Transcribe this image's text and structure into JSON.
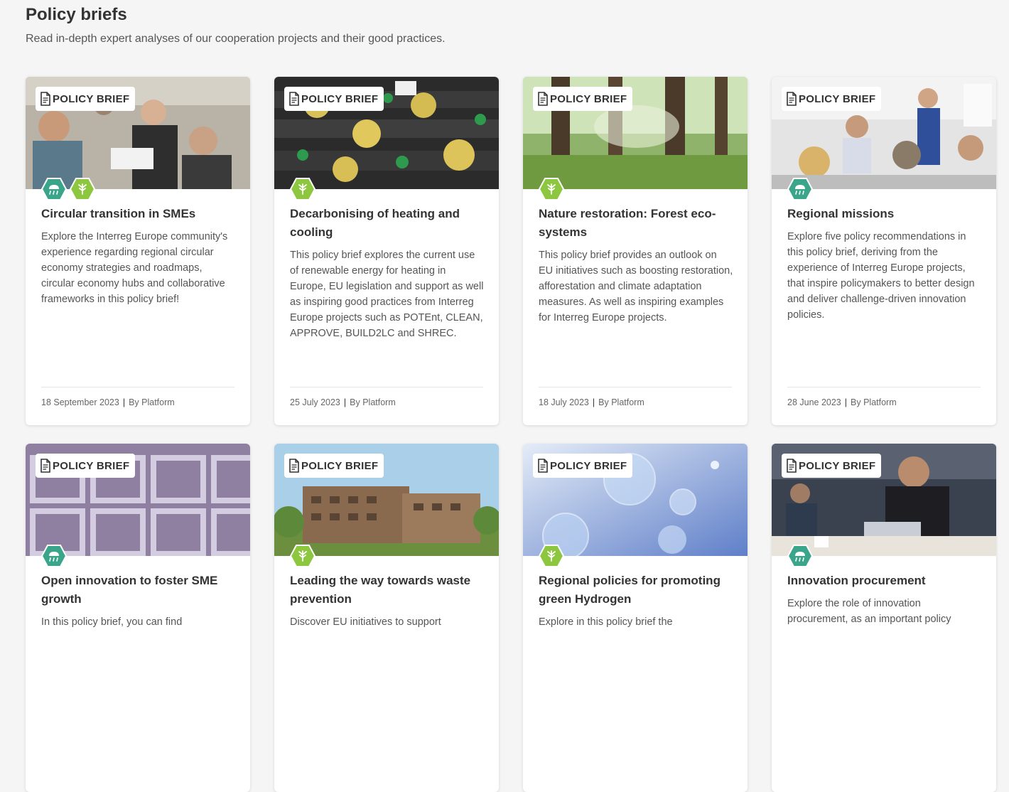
{
  "header": {
    "title": "Policy briefs",
    "subtitle": "Read in-depth expert analyses of our cooperation projects and their good practices."
  },
  "colors": {
    "theme_green": "#8dc63f",
    "theme_teal": "#3aa58a",
    "accent": "#333333"
  },
  "cards": [
    {
      "tag": "POLICY BRIEF",
      "title": "Circular transition in SMEs",
      "description": "Explore the Interreg Europe community's experience regarding regional circular economy strategies and roadmaps, circular economy hubs and collaborative frameworks in this policy brief!",
      "date": "18 September 2023",
      "author": "By Platform",
      "themes": [
        "environment-icon",
        "energy-icon"
      ]
    },
    {
      "tag": "POLICY BRIEF",
      "title": "Decarbonising of heating and cooling",
      "description": "This policy brief explores the current use of renewable energy for heating in Europe, EU legislation and support as well as inspiring good practices from Interreg Europe projects such as POTEnt, CLEAN, APPROVE, BUILD2LC and SHREC.",
      "date": "25 July 2023",
      "author": "By Platform",
      "themes": [
        "energy-icon"
      ]
    },
    {
      "tag": "POLICY BRIEF",
      "title": "Nature restoration: Forest eco-systems",
      "description": "This policy brief provides an outlook on EU initiatives such as boosting restoration, afforestation and climate adaptation measures. As well as inspiring examples for Interreg Europe projects.",
      "date": "18 July 2023",
      "author": "By Platform",
      "themes": [
        "energy-icon"
      ]
    },
    {
      "tag": "POLICY BRIEF",
      "title": "Regional missions",
      "description": "Explore five policy recommendations in this policy brief, deriving from the experience of Interreg Europe projects, that inspire policymakers to better design and deliver challenge-driven innovation policies.",
      "date": "28 June 2023",
      "author": "By Platform",
      "themes": [
        "environment-icon"
      ]
    },
    {
      "tag": "POLICY BRIEF",
      "title": "Open innovation to foster SME growth",
      "description": "In this policy brief, you can find",
      "date": "",
      "author": "",
      "themes": [
        "environment-icon"
      ]
    },
    {
      "tag": "POLICY BRIEF",
      "title": "Leading the way towards waste prevention",
      "description": "Discover EU initiatives to support",
      "date": "",
      "author": "",
      "themes": [
        "energy-icon"
      ]
    },
    {
      "tag": "POLICY BRIEF",
      "title": "Regional policies for promoting green Hydrogen",
      "description": "Explore in this policy brief the",
      "date": "",
      "author": "",
      "themes": [
        "energy-icon"
      ]
    },
    {
      "tag": "POLICY BRIEF",
      "title": "Innovation procurement",
      "description": "Explore the role of innovation procurement, as an important policy",
      "date": "",
      "author": "",
      "themes": [
        "environment-icon"
      ]
    }
  ]
}
